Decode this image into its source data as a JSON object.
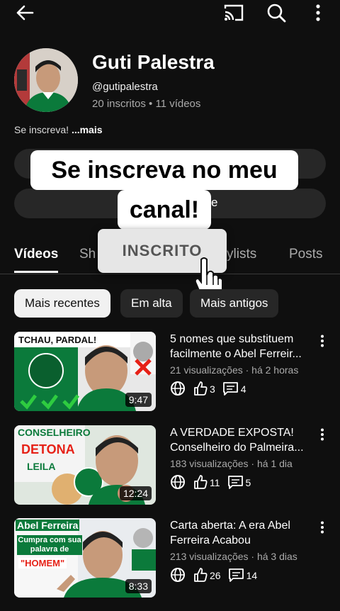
{
  "channel": {
    "name": "Guti Palestra",
    "handle": "@gutipalestra",
    "stats": "20 inscritos • 11 vídeos",
    "description": "Se inscreva!",
    "more": "...mais"
  },
  "overlay": {
    "line1": "Se inscreva no meu",
    "line2": "canal!",
    "behind_text": "e",
    "sticker": "INSCRITO"
  },
  "tabs": [
    {
      "label": "Vídeos"
    },
    {
      "label": "Sh"
    },
    {
      "label": "ylists"
    },
    {
      "label": "Posts"
    }
  ],
  "chips": [
    {
      "label": "Mais recentes"
    },
    {
      "label": "Em alta"
    },
    {
      "label": "Mais antigos"
    }
  ],
  "videos": [
    {
      "title": "5 nomes que substituem facilmente o Abel Ferreir...",
      "meta": "21 visualizações · há 2 horas",
      "duration": "9:47",
      "likes": "3",
      "comments": "4",
      "thumb_text": [
        "TCHAU, PARDAL!"
      ]
    },
    {
      "title": "A VERDADE EXPOSTA! Conselheiro do Palmeira...",
      "meta": "183 visualizações · há 1 dia",
      "duration": "12:24",
      "likes": "11",
      "comments": "5",
      "thumb_text": [
        "CONSELHEIRO",
        "DETONA",
        "LEILA"
      ]
    },
    {
      "title": "Carta aberta: A era Abel Ferreira Acabou",
      "meta": "213 visualizações · há 3 dias",
      "duration": "8:33",
      "likes": "26",
      "comments": "14",
      "thumb_text": [
        "Abel Ferreira",
        "Cumpra com sua palavra de",
        "\"HOMEM\""
      ]
    }
  ],
  "colors": {
    "background": "#0f0f0f",
    "chip": "#272727",
    "palmeiras_green": "#0b7a3b"
  },
  "icons": [
    "back-arrow-icon",
    "cast-icon",
    "search-icon",
    "more-vert-icon",
    "globe-icon",
    "thumb-up-icon",
    "comment-icon",
    "hand-cursor-icon"
  ]
}
